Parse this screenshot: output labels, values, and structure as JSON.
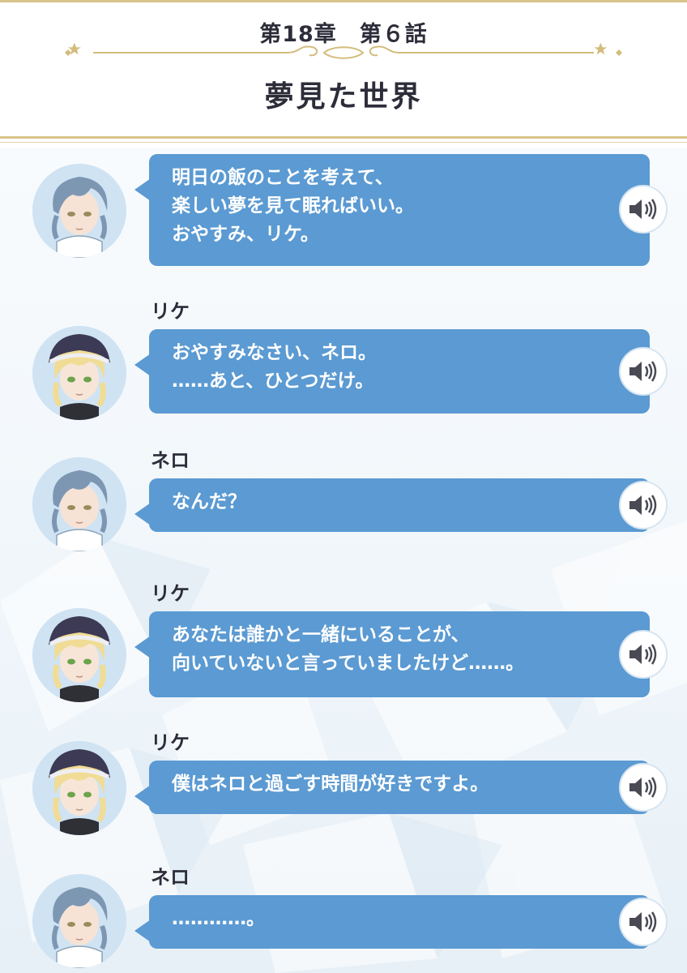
{
  "header": {
    "chapter": "第18章　第６話",
    "title": "夢見た世界"
  },
  "colors": {
    "bubble": "#5b9ad2",
    "gold": "#d8c48a",
    "text_dark": "#2d2d3a"
  },
  "messages": [
    {
      "speaker": "",
      "character": "nero",
      "lines": [
        "明日の飯のことを考えて、",
        "楽しい夢を見て眠ればいい。",
        "おやすみ、リケ。"
      ],
      "voice_icon": "speaker-icon"
    },
    {
      "speaker": "リケ",
      "character": "rike",
      "lines": [
        "おやすみなさい、ネロ。",
        "……あと、ひとつだけ。"
      ],
      "voice_icon": "speaker-icon"
    },
    {
      "speaker": "ネロ",
      "character": "nero",
      "lines": [
        "なんだ？"
      ],
      "voice_icon": "speaker-icon"
    },
    {
      "speaker": "リケ",
      "character": "rike",
      "lines": [
        "あなたは誰かと一緒にいることが、",
        "向いていないと言っていましたけど……。"
      ],
      "voice_icon": "speaker-icon"
    },
    {
      "speaker": "リケ",
      "character": "rike",
      "lines": [
        "僕はネロと過ごす時間が好きですよ。"
      ],
      "voice_icon": "speaker-icon"
    },
    {
      "speaker": "ネロ",
      "character": "nero",
      "lines": [
        "…………。"
      ],
      "voice_icon": "speaker-icon"
    }
  ]
}
